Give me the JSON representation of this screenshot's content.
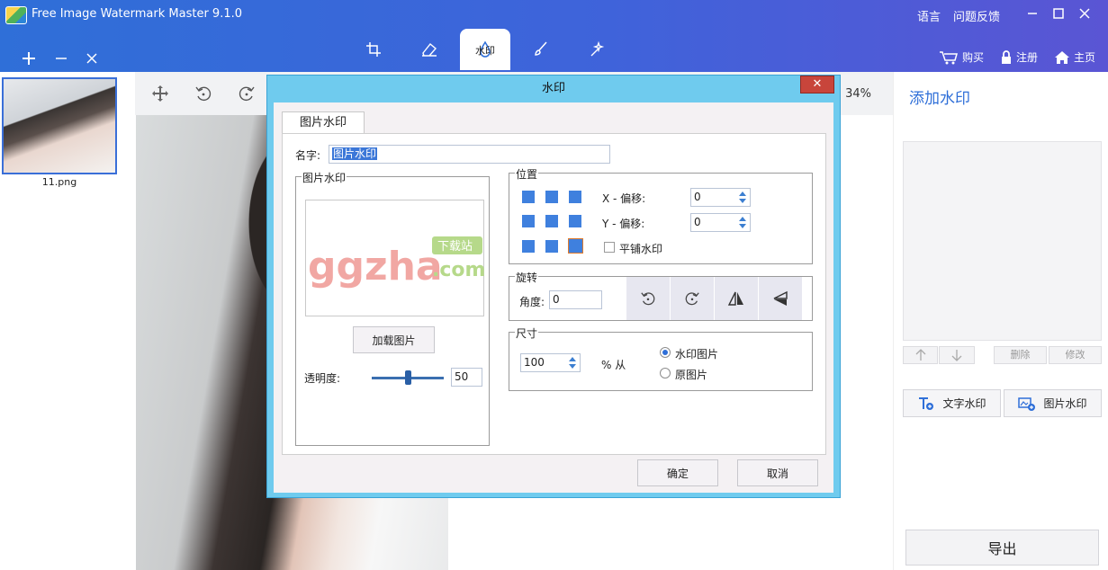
{
  "titlebar": {
    "app_title": "Free Image Watermark Master 9.1.0",
    "links": [
      "语言",
      "问题反馈"
    ],
    "tabs": [
      {
        "name": "crop-tab",
        "label": ""
      },
      {
        "name": "eraser-tab",
        "label": ""
      },
      {
        "name": "watermark-tab",
        "label": "水印"
      },
      {
        "name": "brush-tab",
        "label": ""
      },
      {
        "name": "magic-tab",
        "label": ""
      }
    ],
    "actions": {
      "buy": "购买",
      "register": "注册",
      "home": "主页"
    }
  },
  "files": [
    {
      "name": "11.png"
    }
  ],
  "canvas": {
    "zoom": "34%"
  },
  "right_panel": {
    "title": "添加水印",
    "delete": "删除",
    "modify": "修改",
    "text_watermark": "文字水印",
    "image_watermark": "图片水印",
    "export": "导出"
  },
  "dialog": {
    "title": "水印",
    "tab": "图片水印",
    "name_label": "名字:",
    "name_value": "图片水印",
    "image_group": "图片水印",
    "watermark_text": {
      "main": "ggzha",
      "sub": ".com",
      "badge": "下载站"
    },
    "load_button": "加载图片",
    "opacity_label": "透明度:",
    "opacity_value": "50",
    "opacity": 0.5,
    "position_group": "位置",
    "x_offset_label": "X - 偏移:",
    "x_offset": "0",
    "y_offset_label": "Y - 偏移:",
    "y_offset": "0",
    "tile_label": "平铺水印",
    "rotate_group": "旋转",
    "angle_label": "角度:",
    "angle_value": "0",
    "size_group": "尺寸",
    "size_value": "100",
    "percent_from": "% 从",
    "radio_watermark": "水印图片",
    "radio_original": "原图片",
    "ok": "确定",
    "cancel": "取消"
  },
  "colors": {
    "accent": "#2f6fd8",
    "dialog_frame": "#6fcbee",
    "close": "#c8453b"
  }
}
